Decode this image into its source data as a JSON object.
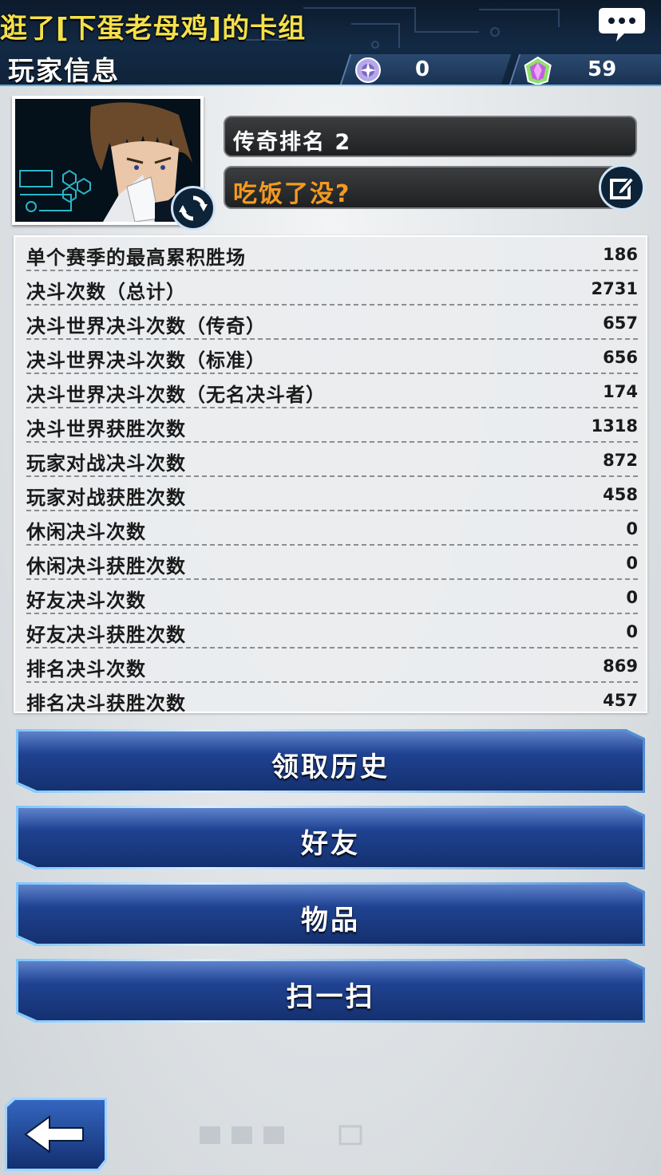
{
  "header": {
    "ticker_text": "逛了[下蛋老母鸡]的卡组",
    "title": "玩家信息",
    "currencies": [
      {
        "icon": "orb-icon",
        "value": "0"
      },
      {
        "icon": "gem-icon",
        "value": "59"
      }
    ],
    "chat_icon": "chat-bubble-icon"
  },
  "profile": {
    "rank_label": "传奇排名 2",
    "message": "吃饭了没?",
    "avatar_icon": "duelist-avatar-icon",
    "refresh_icon": "refresh-icon",
    "edit_icon": "edit-icon"
  },
  "stats": [
    {
      "label": "单个赛季的最高累积胜场",
      "value": "186"
    },
    {
      "label": "决斗次数（总计）",
      "value": "2731"
    },
    {
      "label": "决斗世界决斗次数（传奇）",
      "value": "657"
    },
    {
      "label": "决斗世界决斗次数（标准）",
      "value": "656"
    },
    {
      "label": "决斗世界决斗次数（无名决斗者）",
      "value": "174"
    },
    {
      "label": "决斗世界获胜次数",
      "value": "1318"
    },
    {
      "label": "玩家对战决斗次数",
      "value": "872"
    },
    {
      "label": "玩家对战获胜次数",
      "value": "458"
    },
    {
      "label": "休闲决斗次数",
      "value": "0"
    },
    {
      "label": "休闲决斗获胜次数",
      "value": "0"
    },
    {
      "label": "好友决斗次数",
      "value": "0"
    },
    {
      "label": "好友决斗获胜次数",
      "value": "0"
    },
    {
      "label": "排名决斗次数",
      "value": "869"
    },
    {
      "label": "排名决斗获胜次数",
      "value": "457"
    }
  ],
  "buttons": {
    "history": "领取历史",
    "friends": "好友",
    "items": "物品",
    "scan": "扫一扫"
  },
  "colors": {
    "ticker": "#f4e04a",
    "message": "#f29a22",
    "button": "#1c3d8e",
    "header_bg": "#0c1a2c"
  },
  "back_icon": "back-arrow-icon"
}
